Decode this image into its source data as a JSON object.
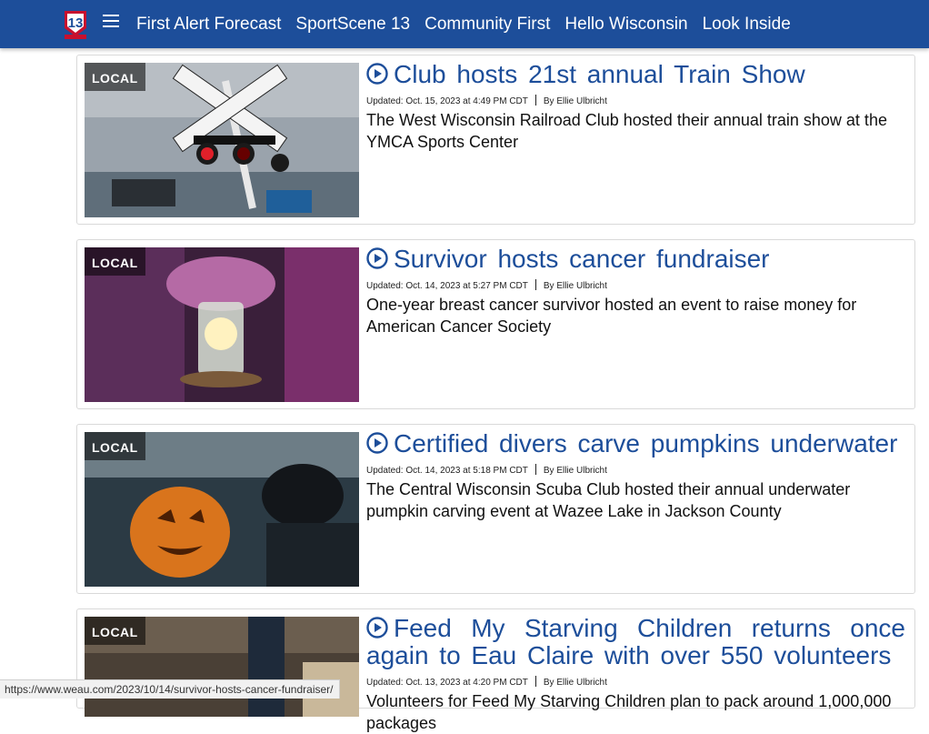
{
  "nav": {
    "links": [
      "First Alert Forecast",
      "SportScene 13",
      "Community First",
      "Hello Wisconsin",
      "Look Inside"
    ]
  },
  "articles": [
    {
      "tag": "LOCAL",
      "title": "Club hosts 21st annual Train Show",
      "updated": "Updated: Oct. 15, 2023 at 4:49 PM CDT",
      "author": "By Ellie Ulbricht",
      "description": "The West Wisconsin Railroad Club hosted their annual train show at the YMCA Sports Center"
    },
    {
      "tag": "LOCAL",
      "title": "Survivor hosts cancer fundraiser",
      "updated": "Updated: Oct. 14, 2023 at 5:27 PM CDT",
      "author": "By Ellie Ulbricht",
      "description": "One-year breast cancer survivor hosted an event to raise money for American Cancer Society"
    },
    {
      "tag": "LOCAL",
      "title": "Certified divers carve pumpkins underwater",
      "updated": "Updated: Oct. 14, 2023 at 5:18 PM CDT",
      "author": "By Ellie Ulbricht",
      "description": "The Central Wisconsin Scuba Club hosted their annual underwater pumpkin carving event at Wazee Lake in Jackson County"
    },
    {
      "tag": "LOCAL",
      "title": "Feed My Starving Children returns once again to Eau Claire with over 550 volunteers",
      "updated": "Updated: Oct. 13, 2023 at 4:20 PM CDT",
      "author": "By Ellie Ulbricht",
      "description": "Volunteers for Feed My Starving Children plan to pack around 1,000,000 packages"
    }
  ],
  "status_url": "https://www.weau.com/2023/10/14/survivor-hosts-cancer-fundraiser/",
  "colors": {
    "nav_bg": "#1d4e9a",
    "title": "#1d4e9a"
  },
  "icons": [
    "weau-13-news-logo",
    "menu-icon",
    "play-icon"
  ]
}
